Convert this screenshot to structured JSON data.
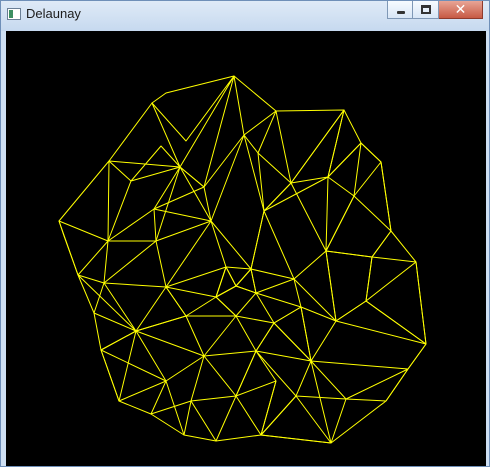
{
  "window": {
    "title": "Delaunay"
  },
  "buttons": {
    "minimize_icon": "minimize-icon",
    "maximize_icon": "maximize-icon",
    "close_icon": "close-icon",
    "close_glyph": "✕"
  },
  "colors": {
    "canvas_background": "#000000",
    "mesh_stroke": "#ffff00"
  }
}
